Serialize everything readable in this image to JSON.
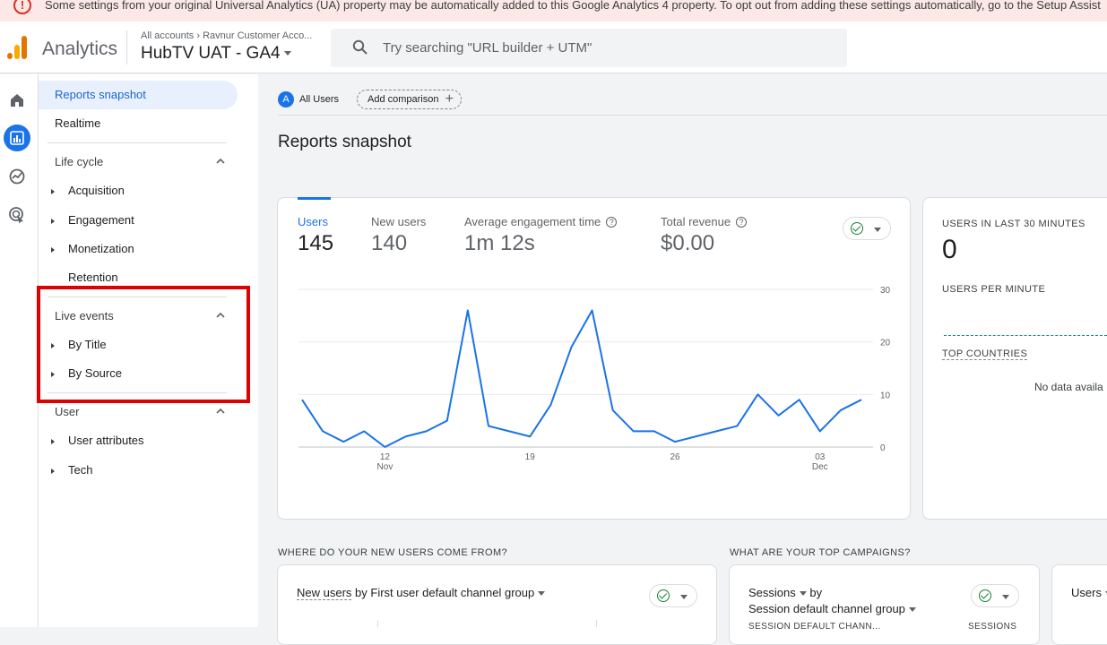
{
  "banner": {
    "text": "Some settings from your original Universal Analytics (UA) property may be automatically added to this Google Analytics 4 property. To opt out from adding these settings automatically, go to the Setup Assist"
  },
  "header": {
    "app_name": "Analytics",
    "account_breadcrumb": "All accounts › Ravnur Customer Acco...",
    "property_name": "HubTV UAT - GA4",
    "search_placeholder": "Try searching \"URL builder + UTM\""
  },
  "nav": {
    "reports_snapshot": "Reports snapshot",
    "realtime": "Realtime",
    "life_cycle": {
      "title": "Life cycle",
      "items": [
        "Acquisition",
        "Engagement",
        "Monetization",
        "Retention"
      ]
    },
    "live_events": {
      "title": "Live events",
      "items": [
        "By Title",
        "By Source"
      ]
    },
    "user": {
      "title": "User",
      "items": [
        "User attributes",
        "Tech"
      ]
    }
  },
  "comparison": {
    "avatar_letter": "A",
    "segment": "All Users",
    "add_label": "Add comparison"
  },
  "page_title": "Reports snapshot",
  "metrics": [
    {
      "label": "Users",
      "value": "145",
      "selected": true
    },
    {
      "label": "New users",
      "value": "140"
    },
    {
      "label": "Average engagement time",
      "value": "1m 12s",
      "help": true
    },
    {
      "label": "Total revenue",
      "value": "$0.00",
      "help": true
    }
  ],
  "realtime": {
    "users_last_30": "USERS IN LAST 30 MINUTES",
    "users_count": "0",
    "users_per_minute": "USERS PER MINUTE",
    "top_countries": "TOP COUNTRIES",
    "no_data": "No data availa"
  },
  "sections": {
    "new_users_title": "WHERE DO YOUR NEW USERS COME FROM?",
    "new_users_metric": "New users",
    "new_users_by": "by First user default channel group",
    "campaigns_title": "WHAT ARE YOUR TOP CAMPAIGNS?",
    "sessions": "Sessions",
    "by": "by",
    "session_channel": "Session default channel group",
    "col_channel": "SESSION DEFAULT CHANN...",
    "col_sessions": "SESSIONS",
    "users_short": "Users"
  },
  "chart_data": {
    "type": "line",
    "series": [
      {
        "values": [
          9,
          3,
          1,
          3,
          0,
          2,
          3,
          5,
          26,
          4,
          3,
          2,
          8,
          19,
          26,
          7,
          3,
          3,
          1,
          2,
          3,
          4,
          10,
          6,
          9,
          3,
          7,
          9
        ]
      }
    ],
    "x_ticks": [
      {
        "index": 4,
        "label": "12",
        "sub": "Nov"
      },
      {
        "index": 11,
        "label": "19",
        "sub": ""
      },
      {
        "index": 18,
        "label": "26",
        "sub": ""
      },
      {
        "index": 25,
        "label": "03",
        "sub": "Dec"
      }
    ],
    "y_ticks": [
      0,
      10,
      20,
      30
    ],
    "ylim": [
      0,
      30
    ],
    "color": "#1a73e8"
  }
}
